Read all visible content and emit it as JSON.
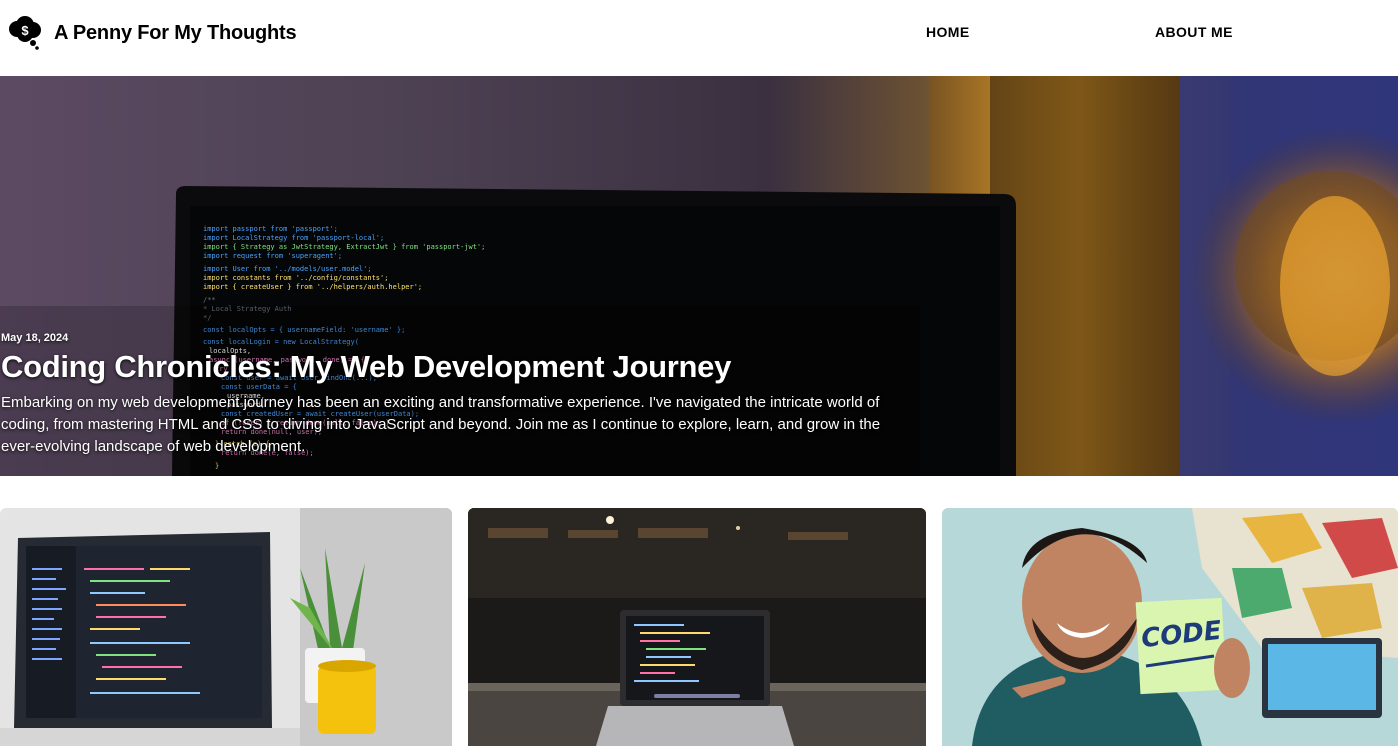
{
  "site": {
    "title": "A Penny For My Thoughts",
    "logo_icon": "thought-cloud-dollar-icon"
  },
  "nav": {
    "items": [
      {
        "label": "HOME"
      },
      {
        "label": "ABOUT ME"
      }
    ]
  },
  "hero": {
    "date": "May 18, 2024",
    "title": "Coding Chronicles: My Web Development Journey",
    "excerpt": "Embarking on my web development journey has been an exciting and transformative experience. I've navigated the intricate world of coding, from mastering HTML and CSS to diving into JavaScript and beyond. Join me as I continue to explore, learn, and grow in the ever-evolving landscape of web development.",
    "image": "laptop-with-code-and-lightbulb"
  },
  "cards": [
    {
      "image": "laptop-code-editor-with-plant-and-yellow-mug"
    },
    {
      "image": "laptop-in-dark-room"
    },
    {
      "image": "smiling-man-holding-code-sticky-note",
      "note_text": "CODE"
    }
  ],
  "colors": {
    "header_bg": "#ffffff",
    "text": "#000000",
    "hero_text": "#ffffff"
  }
}
